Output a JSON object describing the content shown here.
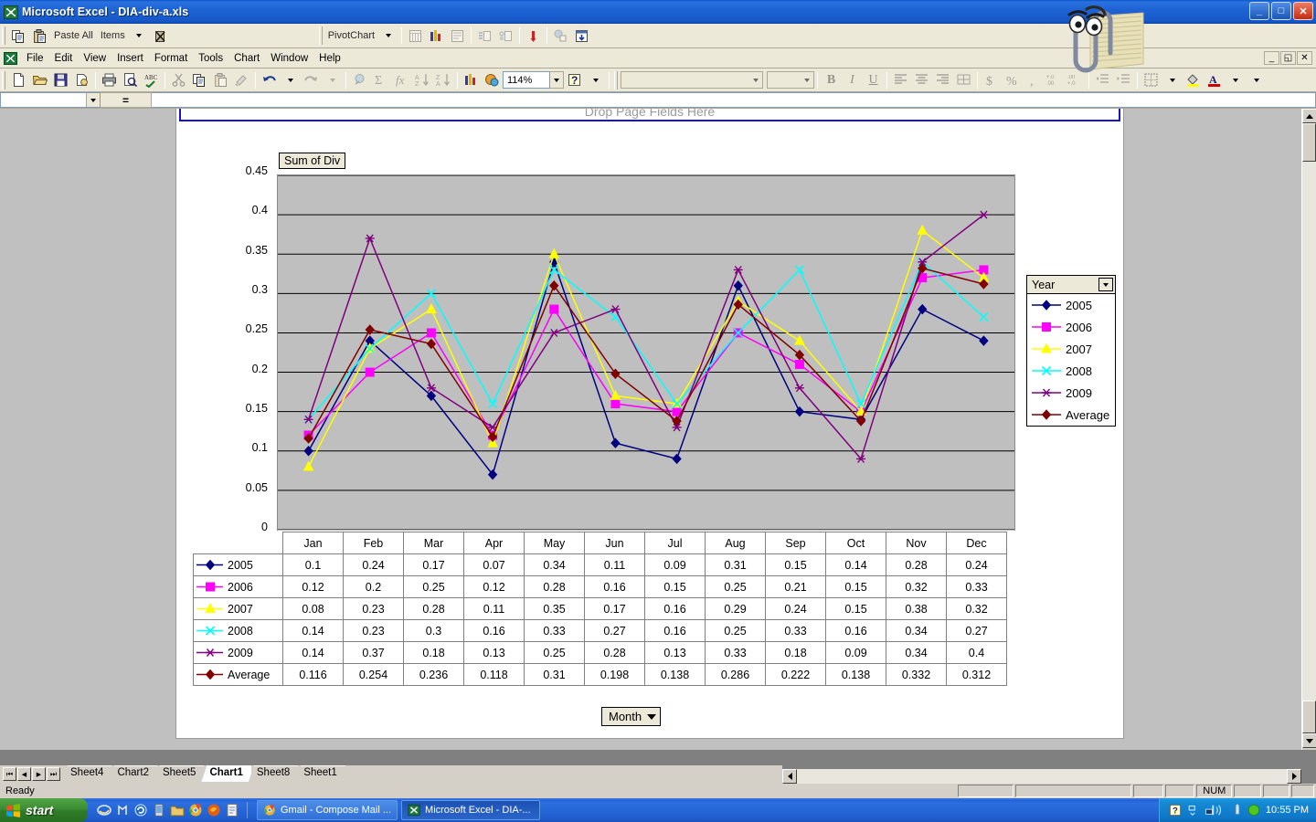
{
  "window": {
    "title": "Microsoft Excel - DIA-div-a.xls",
    "minimize_label": "_",
    "restore_label": "□",
    "close_label": "✕"
  },
  "mdi_buttons": {
    "minimize": "_",
    "restore": "◱",
    "close": "✕"
  },
  "clipboard_toolbar": {
    "copy_icon": "copy-icon",
    "paste_all_label": "Paste All",
    "items_label": "Items",
    "clear_icon": "clear-clipboard-icon"
  },
  "pivot_toolbar": {
    "menu_label": "PivotChart",
    "buttons": [
      "field-list-icon",
      "chart-wizard-icon",
      "format-report-icon",
      "hide-detail-icon",
      "show-detail-icon",
      "refresh-icon",
      "field-settings-icon",
      "include-hidden-icon"
    ]
  },
  "menubar": {
    "items": [
      "File",
      "Edit",
      "View",
      "Insert",
      "Format",
      "Tools",
      "Chart",
      "Window",
      "Help"
    ]
  },
  "standard_toolbar": {
    "buttons": [
      "new-icon",
      "open-icon",
      "save-icon",
      "permission-icon",
      "print-icon",
      "print-preview-icon",
      "spelling-icon",
      "cut-icon",
      "copy-icon",
      "paste-icon",
      "format-painter-icon",
      "undo-icon",
      "redo-icon",
      "hyperlink-icon",
      "autosum-icon",
      "insert-function-icon",
      "sort-asc-icon",
      "sort-desc-icon",
      "chart-wizard-icon",
      "drawing-icon"
    ],
    "zoom_value": "114%",
    "help_icon": "help-icon"
  },
  "formatting_toolbar": {
    "font_value": "",
    "size_value": "",
    "bold_label": "B",
    "italic_label": "I",
    "underline_label": "U",
    "buttons": [
      "align-left-icon",
      "align-center-icon",
      "align-right-icon",
      "merge-center-icon",
      "currency-icon",
      "percent-icon",
      "comma-icon",
      "increase-decimal-icon",
      "decrease-decimal-icon",
      "decrease-indent-icon",
      "increase-indent-icon",
      "borders-icon",
      "fill-color-icon",
      "font-color-icon"
    ]
  },
  "formula_bar": {
    "name_box_value": "",
    "fx_label": "=",
    "formula_value": ""
  },
  "chart_sheet": {
    "page_field_drop_text": "Drop Page Fields Here",
    "value_field_button": "Sum of Div",
    "category_field_button": "Month",
    "legend_title": "Year"
  },
  "chart_data": {
    "type": "line",
    "title": "Sum of Div",
    "xlabel": "Month",
    "ylabel": "Sum of Div",
    "ylim": [
      0,
      0.45
    ],
    "ytick_step": 0.05,
    "yticks": [
      "0",
      "0.05",
      "0.1",
      "0.15",
      "0.2",
      "0.25",
      "0.3",
      "0.35",
      "0.4",
      "0.45"
    ],
    "grid": true,
    "legend_position": "right",
    "legend_title": "Year",
    "categories": [
      "Jan",
      "Feb",
      "Mar",
      "Apr",
      "May",
      "Jun",
      "Jul",
      "Aug",
      "Sep",
      "Oct",
      "Nov",
      "Dec"
    ],
    "series": [
      {
        "name": "2005",
        "color": "#000080",
        "marker": "diamond",
        "values": [
          0.1,
          0.24,
          0.17,
          0.07,
          0.34,
          0.11,
          0.09,
          0.31,
          0.15,
          0.14,
          0.28,
          0.24
        ],
        "labels": [
          "0.1",
          "0.24",
          "0.17",
          "0.07",
          "0.34",
          "0.11",
          "0.09",
          "0.31",
          "0.15",
          "0.14",
          "0.28",
          "0.24"
        ]
      },
      {
        "name": "2006",
        "color": "#FF00FF",
        "marker": "square",
        "values": [
          0.12,
          0.2,
          0.25,
          0.12,
          0.28,
          0.16,
          0.15,
          0.25,
          0.21,
          0.15,
          0.32,
          0.33
        ],
        "labels": [
          "0.12",
          "0.2",
          "0.25",
          "0.12",
          "0.28",
          "0.16",
          "0.15",
          "0.25",
          "0.21",
          "0.15",
          "0.32",
          "0.33"
        ]
      },
      {
        "name": "2007",
        "color": "#FFFF00",
        "marker": "triangle",
        "values": [
          0.08,
          0.23,
          0.28,
          0.11,
          0.35,
          0.17,
          0.16,
          0.29,
          0.24,
          0.15,
          0.38,
          0.32
        ],
        "labels": [
          "0.08",
          "0.23",
          "0.28",
          "0.11",
          "0.35",
          "0.17",
          "0.16",
          "0.29",
          "0.24",
          "0.15",
          "0.38",
          "0.32"
        ]
      },
      {
        "name": "2008",
        "color": "#00FFFF",
        "marker": "x",
        "values": [
          0.14,
          0.23,
          0.3,
          0.16,
          0.33,
          0.27,
          0.16,
          0.25,
          0.33,
          0.16,
          0.34,
          0.27
        ],
        "labels": [
          "0.14",
          "0.23",
          "0.3",
          "0.16",
          "0.33",
          "0.27",
          "0.16",
          "0.25",
          "0.33",
          "0.16",
          "0.34",
          "0.27"
        ]
      },
      {
        "name": "2009",
        "color": "#800080",
        "marker": "star",
        "values": [
          0.14,
          0.37,
          0.18,
          0.13,
          0.25,
          0.28,
          0.13,
          0.33,
          0.18,
          0.09,
          0.34,
          0.4
        ],
        "labels": [
          "0.14",
          "0.37",
          "0.18",
          "0.13",
          "0.25",
          "0.28",
          "0.13",
          "0.33",
          "0.18",
          "0.09",
          "0.34",
          "0.4"
        ]
      },
      {
        "name": "Average",
        "color": "#800000",
        "marker": "diamond",
        "values": [
          0.116,
          0.254,
          0.236,
          0.118,
          0.31,
          0.198,
          0.138,
          0.286,
          0.222,
          0.138,
          0.332,
          0.312
        ],
        "labels": [
          "0.116",
          "0.254",
          "0.236",
          "0.118",
          "0.31",
          "0.198",
          "0.138",
          "0.286",
          "0.222",
          "0.138",
          "0.332",
          "0.312"
        ]
      }
    ]
  },
  "sheet_tabs": {
    "items": [
      "Sheet4",
      "Chart2",
      "Sheet5",
      "Chart1",
      "Sheet8",
      "Sheet1"
    ],
    "active": "Chart1",
    "nav_first": "⏮",
    "nav_prev": "◀",
    "nav_next": "▶",
    "nav_last": "⏭"
  },
  "status_bar": {
    "message": "Ready",
    "num_lock": "NUM"
  },
  "taskbar": {
    "start_label": "start",
    "quick_launch": [
      "internet-explorer-icon",
      "media-icon",
      "refresh-icon",
      "device-icon",
      "folder-icon",
      "chrome-icon",
      "firefox-icon",
      "notepad-icon"
    ],
    "windows": [
      {
        "label": "Gmail - Compose Mail ...",
        "icon": "chrome-icon"
      },
      {
        "label": "Microsoft Excel - DIA-...",
        "icon": "excel-icon"
      }
    ],
    "tray_icons": [
      "help-icon",
      "expand-icon",
      "network-icon",
      "usb-icon",
      "green-circle-icon"
    ],
    "clock": "10:55 PM"
  },
  "office_assistant": {
    "name": "clippy-assistant"
  }
}
